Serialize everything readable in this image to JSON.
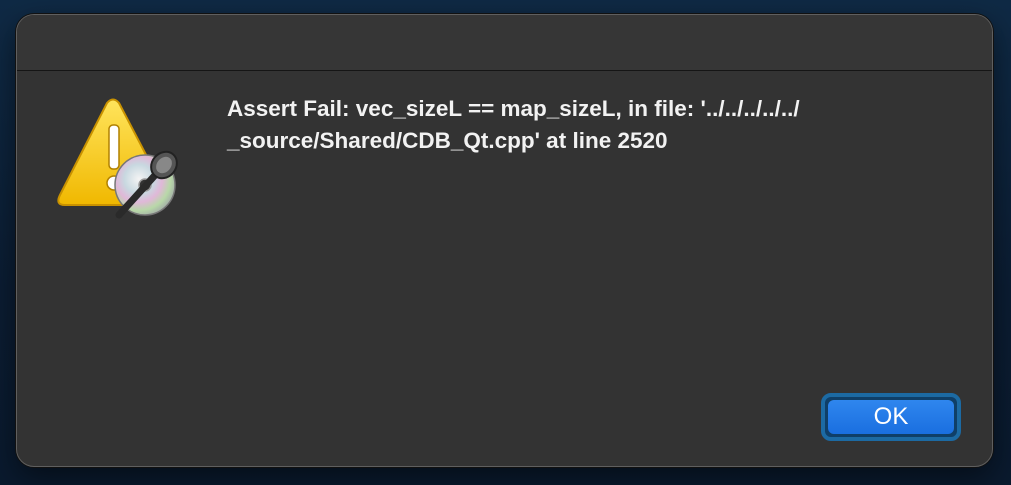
{
  "dialog": {
    "message_line1": "Assert Fail: vec_sizeL == map_sizeL, in file: '../../../../../",
    "message_line2": "_source/Shared/CDB_Qt.cpp' at line 2520",
    "ok_label": "OK",
    "icon": "warning-triangle-with-app-badge-icon"
  },
  "colors": {
    "dialog_bg": "#333333",
    "text": "#f2f2f2",
    "accent": "#1a6fe0",
    "warning_yellow": "#f5c400"
  }
}
